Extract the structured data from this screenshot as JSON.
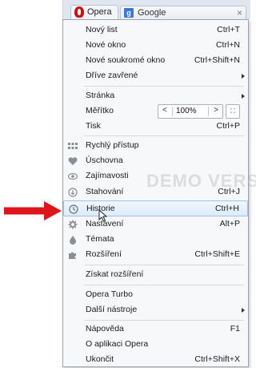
{
  "tabs": {
    "opera_label": "Opera",
    "google_label": "Google",
    "close_glyph": "×"
  },
  "menu": {
    "new_tab": {
      "label": "Nový list",
      "shortcut": "Ctrl+T"
    },
    "new_window": {
      "label": "Nové okno",
      "shortcut": "Ctrl+N"
    },
    "new_private_window": {
      "label": "Nové soukromé okno",
      "shortcut": "Ctrl+Shift+N"
    },
    "recently_closed": {
      "label": "Dříve zavřené"
    },
    "page": {
      "label": "Stránka"
    },
    "zoom": {
      "label": "Měřítko",
      "value": "100%",
      "left": "<",
      "right": ">"
    },
    "print": {
      "label": "Tisk",
      "shortcut": "Ctrl+P"
    },
    "speed_dial": {
      "label": "Rychlý přístup"
    },
    "stash": {
      "label": "Úschovna"
    },
    "discover": {
      "label": "Zajímavosti"
    },
    "downloads": {
      "label": "Stahování",
      "shortcut": "Ctrl+J"
    },
    "history": {
      "label": "Historie",
      "shortcut": "Ctrl+H"
    },
    "settings": {
      "label": "Nastavení",
      "shortcut": "Alt+P"
    },
    "themes": {
      "label": "Témata"
    },
    "extensions": {
      "label": "Rozšíření",
      "shortcut": "Ctrl+Shift+E"
    },
    "get_extensions": {
      "label": "Získat rozšíření"
    },
    "opera_turbo": {
      "label": "Opera Turbo"
    },
    "more_tools": {
      "label": "Další nástroje"
    },
    "help": {
      "label": "Nápověda",
      "shortcut": "F1"
    },
    "about": {
      "label": "O aplikaci Opera"
    },
    "exit": {
      "label": "Ukončit",
      "shortcut": "Ctrl+Shift+X"
    }
  },
  "watermark": "DEMO VERSION",
  "colors": {
    "highlight_border": "#9cc2ec",
    "arrow_red": "#e0141b",
    "opera_red": "#cc0f16"
  }
}
